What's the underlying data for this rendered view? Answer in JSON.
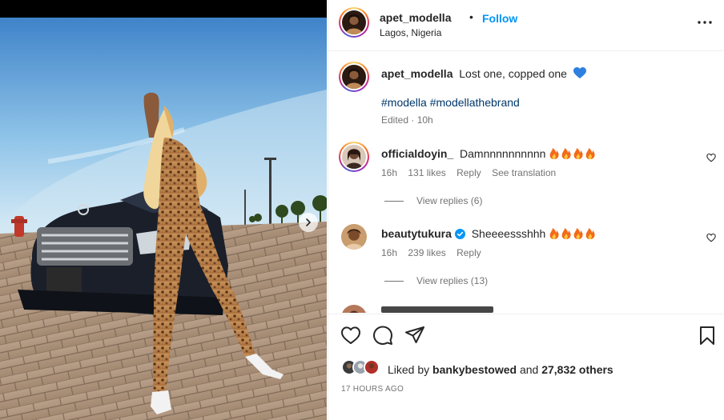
{
  "post": {
    "username": "apet_modella",
    "separator": "•",
    "follow_label": "Follow",
    "location": "Lagos, Nigeria",
    "more_icon": "more-horizontal-icon"
  },
  "caption": {
    "username": "apet_modella",
    "text": "Lost one, copped one",
    "emoji": "blue-heart",
    "hashtag_1": "#modella",
    "hashtag_2": "#modellathebrand",
    "meta": "Edited · 10h"
  },
  "comments": [
    {
      "username": "officialdoyin_",
      "text": "Damnnnnnnnnnn",
      "emoji_count": 4,
      "time": "16h",
      "likes": "131 likes",
      "reply": "Reply",
      "translate": "See translation",
      "view_replies": "View replies (6)"
    },
    {
      "username": "beautytukura",
      "verified": true,
      "text": "Sheeeessshhh",
      "emoji_count": 4,
      "time": "16h",
      "likes": "239 likes",
      "reply": "Reply",
      "view_replies": "View replies (13)"
    }
  ],
  "engagement": {
    "liked_prefix": "Liked by",
    "liked_user": "bankybestowed",
    "liked_and": "and",
    "liked_count": "27,832 others",
    "timestamp": "17 HOURS AGO"
  },
  "icons": {
    "like": "heart-outline-icon",
    "comment": "comment-icon",
    "share": "share-icon",
    "save": "bookmark-icon"
  },
  "colors": {
    "accent": "#0095f6",
    "hashtag": "#00376b",
    "muted": "#737373",
    "verified": "#0095f6"
  }
}
